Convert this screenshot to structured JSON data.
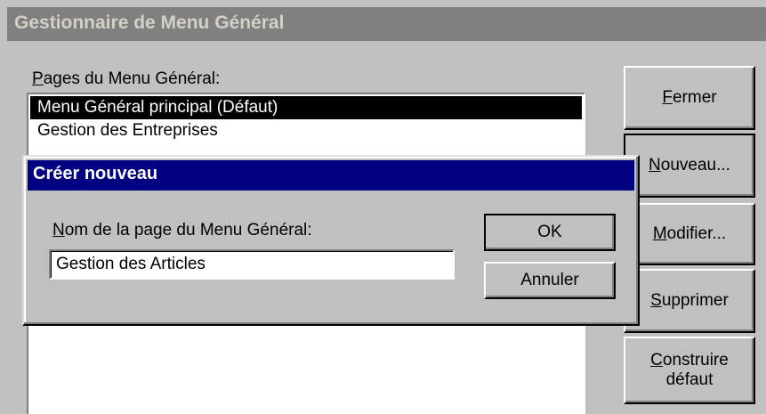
{
  "window": {
    "title": "Gestionnaire de Menu Général"
  },
  "list": {
    "label_accel": "P",
    "label_rest": "ages du Menu Général:",
    "items": [
      {
        "label": "Menu Général principal (Défaut)",
        "selected": true
      },
      {
        "label": "Gestion des Entreprises",
        "selected": false
      }
    ]
  },
  "buttons": {
    "close": {
      "accel": "F",
      "rest": "ermer"
    },
    "new": {
      "accel": "N",
      "rest": "ouveau..."
    },
    "edit": {
      "accel": "M",
      "rest": "odifier..."
    },
    "delete": {
      "accel": "S",
      "rest": "upprimer"
    },
    "build_default": {
      "accel": "C",
      "rest1": "onstruire",
      "line2": "défaut"
    }
  },
  "dialog": {
    "title": "Créer nouveau",
    "field_label_accel": "N",
    "field_label_rest": "om de la page du Menu Général:",
    "field_value": "Gestion des Articles",
    "ok_label": "OK",
    "cancel_label": "Annuler"
  },
  "colors": {
    "window_titlebar": "#808080",
    "dialog_titlebar": "#000080",
    "face": "#c0c0c0",
    "selection": "#000000"
  }
}
